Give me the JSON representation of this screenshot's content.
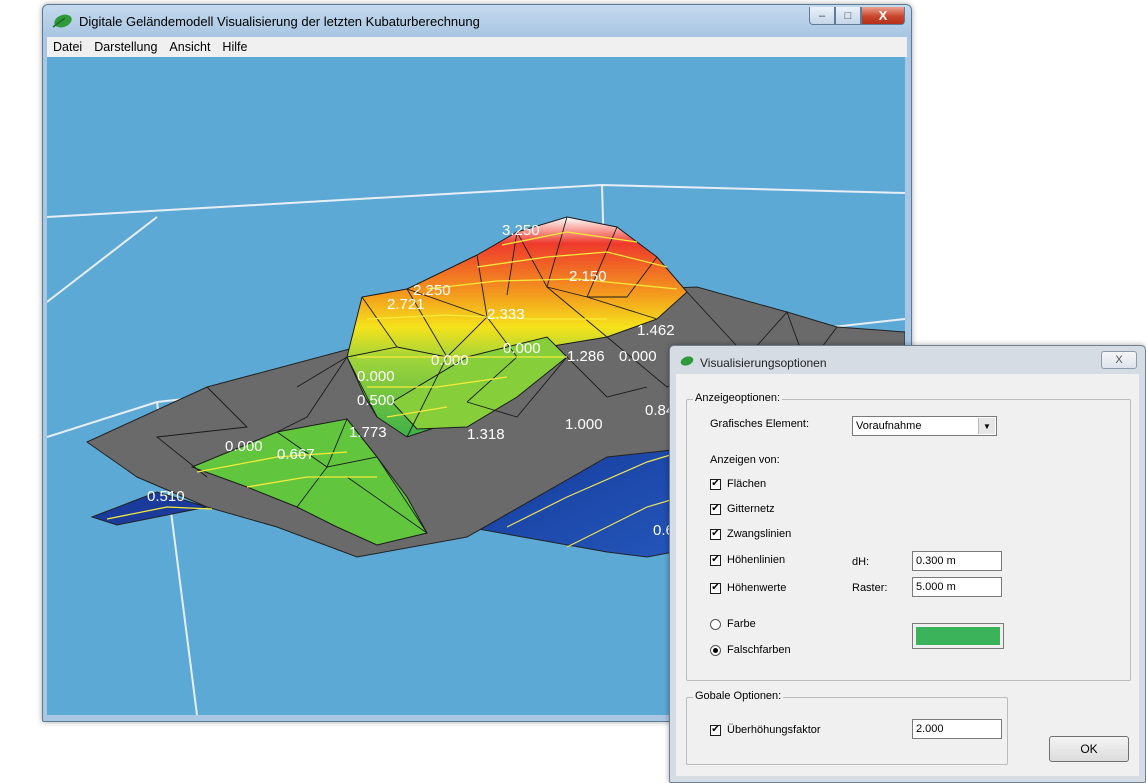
{
  "main_window": {
    "title": "Digitale Geländemodell Visualisierung der letzten Kubaturberechnung",
    "caption_buttons": [
      "–",
      "□",
      "X"
    ],
    "menu": [
      "Datei",
      "Darstellung",
      "Ansicht",
      "Hilfe"
    ]
  },
  "viewport": {
    "background_color": "#5da9d6",
    "height_labels": [
      "3.250",
      "2.150",
      "2.250",
      "2.721",
      "2.333",
      "1.462",
      "0.000",
      "1.286",
      "0.000",
      "0.000",
      "0.000",
      "0.500",
      "1.773",
      "1.318",
      "1.000",
      "0.84",
      "0.000",
      "0.667",
      "0.510",
      "0.6"
    ]
  },
  "dialog": {
    "title": "Visualisierungsoptionen",
    "close_label": "X",
    "display_options": {
      "legend": "Anzeigeoptionen:",
      "graphic_element_label": "Grafisches Element:",
      "graphic_element_value": "Voraufnahme",
      "show_label": "Anzeigen von:",
      "checkboxes": [
        {
          "label": "Flächen",
          "checked": true
        },
        {
          "label": "Gitternetz",
          "checked": true
        },
        {
          "label": "Zwangslinien",
          "checked": true
        },
        {
          "label": "Höhenlinien",
          "checked": true
        },
        {
          "label": "Höhenwerte",
          "checked": true
        }
      ],
      "dh_label": "dH:",
      "dh_value": "0.300 m",
      "raster_label": "Raster:",
      "raster_value": "5.000 m",
      "radio_color": {
        "label": "Farbe",
        "selected": false
      },
      "radio_false": {
        "label": "Falschfarben",
        "selected": true
      },
      "color_value": "#3bb35a"
    },
    "global_options": {
      "legend": "Gobale Optionen:",
      "exaggeration_label": "Überhöhungsfaktor",
      "exaggeration_checked": true,
      "exaggeration_value": "2.000"
    },
    "ok_label": "OK"
  }
}
